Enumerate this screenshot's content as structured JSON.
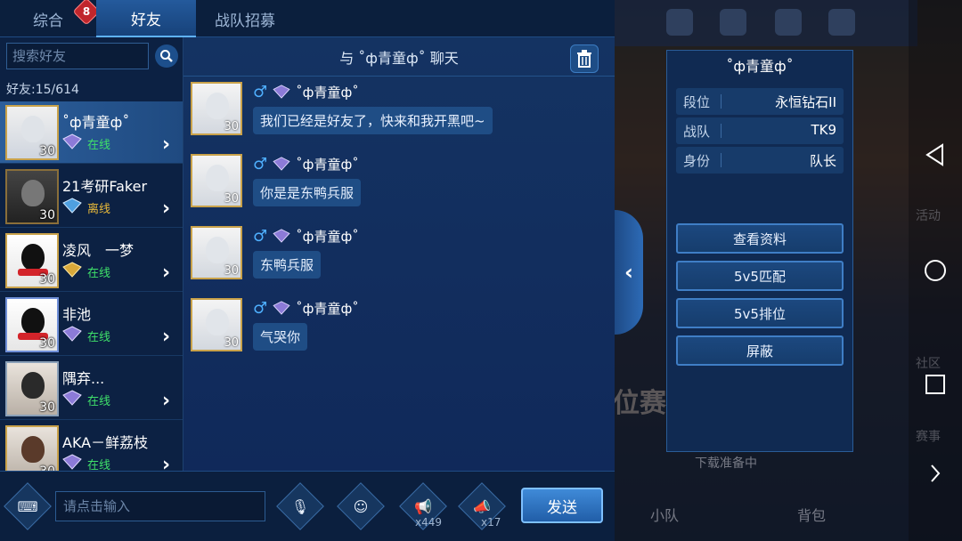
{
  "tabs": {
    "general": "综合",
    "general_badge": "8",
    "friends": "好友",
    "recruit": "战队招募"
  },
  "friends": {
    "search_placeholder": "搜索好友",
    "count": "好友:15/614",
    "list": [
      {
        "name": "˚ф青童ф˚",
        "level": "30",
        "status": "在线",
        "status_type": "online"
      },
      {
        "name": "21考研Faker",
        "level": "30",
        "status": "离线",
        "status_type": "offline"
      },
      {
        "name": "凌风　一梦",
        "level": "30",
        "status": "在线",
        "status_type": "online"
      },
      {
        "name": "非池",
        "level": "30",
        "status": "在线",
        "status_type": "online"
      },
      {
        "name": "隅弃...",
        "level": "30",
        "status": "在线",
        "status_type": "online"
      },
      {
        "name": "AKA－鲜荔枝",
        "level": "30",
        "status": "在线",
        "status_type": "online"
      }
    ]
  },
  "chat": {
    "title": "与 ˚ф青童ф˚ 聊天",
    "messages": [
      {
        "name": "˚ф青童ф˚",
        "level": "30",
        "text": "我们已经是好友了，快来和我开黑吧~"
      },
      {
        "name": "˚ф青童ф˚",
        "level": "30",
        "text": "你是是东鸭兵服"
      },
      {
        "name": "˚ф青童ф˚",
        "level": "30",
        "text": "东鸭兵服"
      },
      {
        "name": "˚ф青童ф˚",
        "level": "30",
        "text": "气哭你"
      }
    ]
  },
  "input": {
    "placeholder": "请点击输入",
    "horn_big_count": "x449",
    "horn_small_count": "x17",
    "send_label": "发送"
  },
  "profile": {
    "name": "˚ф青童ф˚",
    "rows": [
      {
        "key": "段位",
        "value": "永恒钻石II"
      },
      {
        "key": "战队",
        "value": "TK9"
      },
      {
        "key": "身份",
        "value": "队长"
      }
    ],
    "buttons": {
      "view_profile": "查看资料",
      "match_5v5": "5v5匹配",
      "ranked_5v5": "5v5排位",
      "block": "屏蔽"
    }
  },
  "game_bg": {
    "labels": [
      "小队",
      "背包",
      "下载准备中",
      "社区",
      "赛事",
      "活动",
      "位赛"
    ]
  },
  "colors": {
    "online": "#3fe06a",
    "offline": "#e8b93a",
    "accent": "#5fb2ff",
    "badge": "#c0262c"
  }
}
